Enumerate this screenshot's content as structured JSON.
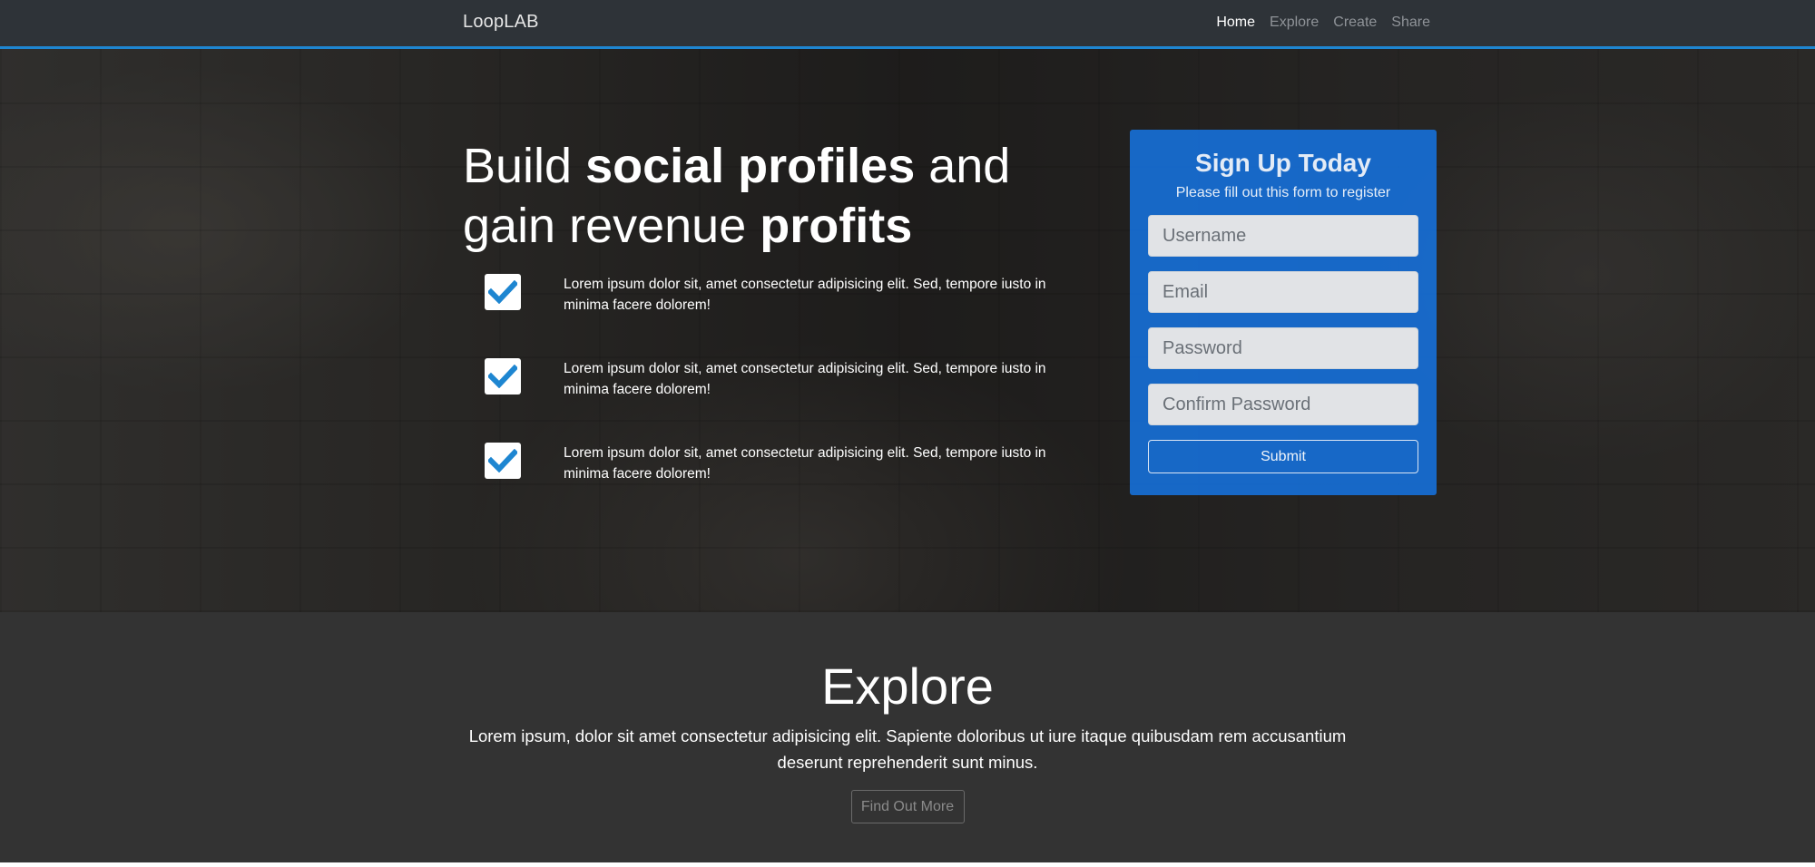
{
  "navbar": {
    "brand": "LoopLAB",
    "links": [
      {
        "label": "Home",
        "active": true
      },
      {
        "label": "Explore",
        "active": false
      },
      {
        "label": "Create",
        "active": false
      },
      {
        "label": "Share",
        "active": false
      }
    ]
  },
  "hero": {
    "title_parts": [
      "Build ",
      "social profiles",
      " and gain revenue ",
      "profits"
    ],
    "features": [
      {
        "icon": "check-icon",
        "text": "Lorem ipsum dolor sit, amet consectetur adipisicing elit. Sed, tempore iusto in minima facere dolorem!"
      },
      {
        "icon": "check-icon",
        "text": "Lorem ipsum dolor sit, amet consectetur adipisicing elit. Sed, tempore iusto in minima facere dolorem!"
      },
      {
        "icon": "check-icon",
        "text": "Lorem ipsum dolor sit, amet consectetur adipisicing elit. Sed, tempore iusto in minima facere dolorem!"
      }
    ]
  },
  "signup": {
    "title": "Sign Up Today",
    "subtitle": "Please fill out this form to register",
    "fields": {
      "username": {
        "placeholder": "Username",
        "value": ""
      },
      "email": {
        "placeholder": "Email",
        "value": ""
      },
      "password": {
        "placeholder": "Password",
        "value": ""
      },
      "confirm_password": {
        "placeholder": "Confirm Password",
        "value": ""
      }
    },
    "submit_label": "Submit"
  },
  "explore": {
    "title": "Explore",
    "text": "Lorem ipsum, dolor sit amet consectetur adipisicing elit. Sapiente doloribus ut iure itaque quibusdam rem accusantium deserunt reprehenderit sunt minus.",
    "button_label": "Find Out More"
  },
  "colors": {
    "navbar_bg": "#2e3338",
    "navbar_accent": "#1e86d1",
    "signup_bg": "#1672de",
    "check_color": "#1e86d1",
    "explore_bg": "#333333"
  }
}
